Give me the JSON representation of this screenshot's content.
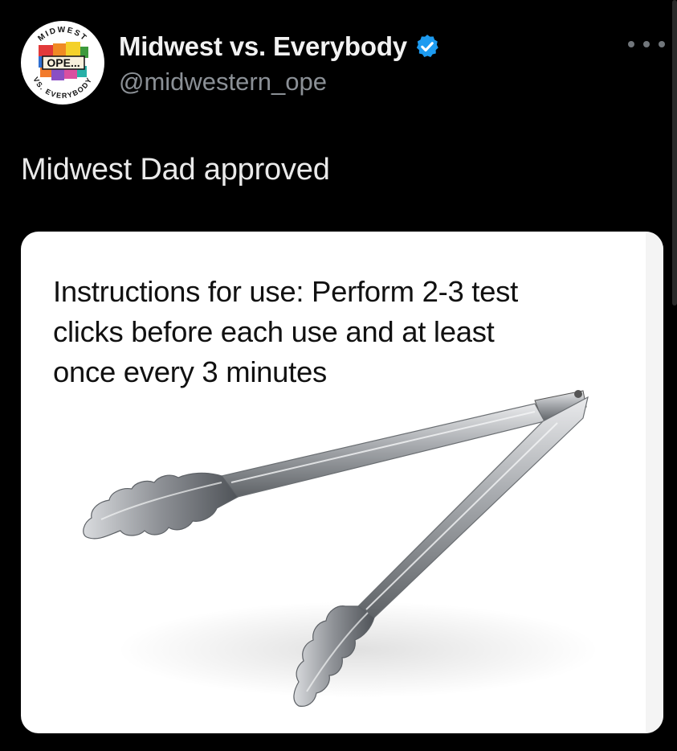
{
  "account": {
    "display_name": "Midwest vs. Everybody",
    "handle": "@midwestern_ope",
    "verified_icon": "verified-badge-icon",
    "avatar": {
      "top_text": "MIDWEST",
      "center_text": "OPE...",
      "bottom_text": "VS. EVERYBODY"
    }
  },
  "post": {
    "text": "Midwest Dad approved",
    "more_icon": "more-options-icon"
  },
  "media": {
    "caption_lines": [
      "Instructions for use: Perform 2-3 test",
      "clicks before each use and at least",
      "once every 3 minutes"
    ],
    "image_subject": "tongs-image"
  },
  "colors": {
    "background": "#000000",
    "handle": "#8b9096",
    "verified": "#1d9bf0",
    "media_bg": "#ffffff"
  }
}
